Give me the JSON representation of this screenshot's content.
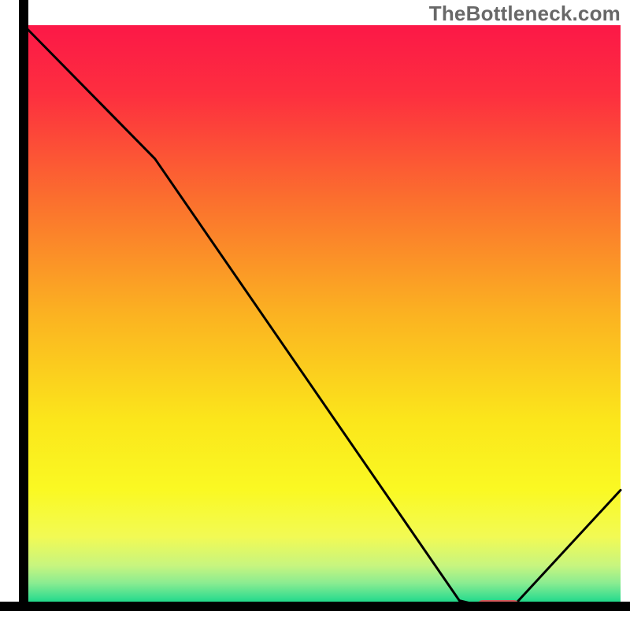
{
  "watermark": "TheBottleneck.com",
  "chart_data": {
    "type": "line",
    "title": "",
    "xlabel": "",
    "ylabel": "",
    "xlim": [
      0,
      100
    ],
    "ylim": [
      0,
      100
    ],
    "grid": false,
    "annotations": [],
    "series": [
      {
        "name": "curve",
        "x": [
          0,
          22,
          73,
          77,
          82,
          100
        ],
        "values": [
          100,
          77,
          1,
          0,
          0,
          20
        ]
      }
    ],
    "marker": {
      "name": "optimal-range",
      "x_start": 76,
      "x_end": 83,
      "y": 0.2,
      "color": "#d45a5c"
    },
    "background_gradient": {
      "stops": [
        {
          "pos": 0.0,
          "color": "#fc1847"
        },
        {
          "pos": 0.12,
          "color": "#fd2f3f"
        },
        {
          "pos": 0.3,
          "color": "#fb6f2e"
        },
        {
          "pos": 0.5,
          "color": "#fbb321"
        },
        {
          "pos": 0.68,
          "color": "#fbe61b"
        },
        {
          "pos": 0.8,
          "color": "#faf923"
        },
        {
          "pos": 0.88,
          "color": "#f2fa54"
        },
        {
          "pos": 0.93,
          "color": "#c7f57f"
        },
        {
          "pos": 0.96,
          "color": "#8aec91"
        },
        {
          "pos": 0.985,
          "color": "#3ade8f"
        },
        {
          "pos": 1.0,
          "color": "#06d283"
        }
      ]
    },
    "axes_color": "#000000",
    "curve_color": "#000000",
    "curve_width": 3
  }
}
